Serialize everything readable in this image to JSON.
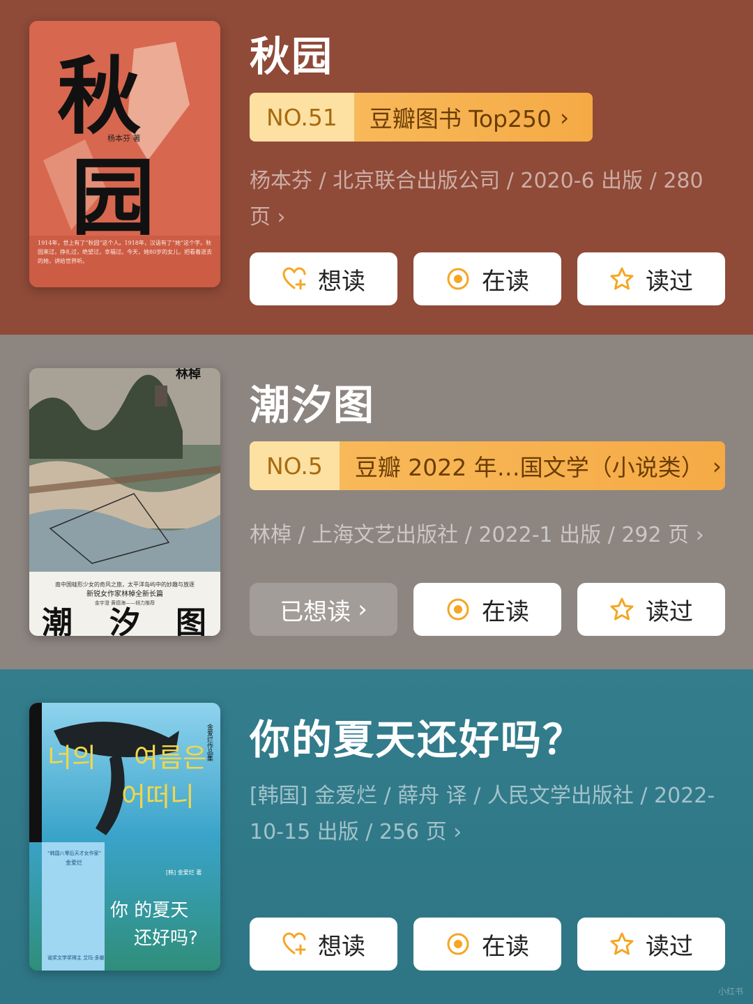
{
  "books": [
    {
      "title": "秋园",
      "rank_no": "NO.51",
      "rank_list": "豆瓣图书 Top250",
      "meta": "杨本芬 / 北京联合出版公司 / 2020-6 出版 / 280 页",
      "buttons": {
        "want": "想读",
        "reading": "在读",
        "read": "读过"
      },
      "cover": {
        "title_char_1": "秋",
        "title_char_2": "园",
        "author": "杨本芬 著",
        "blurb": "1914年，世上有了“秋园”这个人。1918年，汉语有了“她”这个字。秋园来过，挣扎过，绝望过，幸福过。今天，她80岁的女儿，把看着逝去的她，讲给世界听。"
      },
      "colors": {
        "bg": "#8f4a38",
        "cover": "#d8674f"
      }
    },
    {
      "title": "潮汐图",
      "rank_no": "NO.5",
      "rank_list": "豆瓣 2022 年…国文学（小说类）",
      "meta": "林棹 / 上海文艺出版社 / 2022-1 出版 / 292 页",
      "buttons": {
        "want": "已想读",
        "reading": "在读",
        "read": "读过"
      },
      "cover": {
        "author": "林棹",
        "line1": "南中国蛙形少女的奇风之旅，太平洋岛屿中的妙趣与放逐",
        "line2": "新锐女作家林棹全新长篇",
        "line3": "金宇澄  黄德海——倾力推荐",
        "title_chars": [
          "潮",
          "汐",
          "图"
        ]
      },
      "colors": {
        "bg": "#8d8580"
      }
    },
    {
      "title": "你的夏天还好吗？",
      "meta": "[韩国] 金爱烂 / 薛舟 译 / 人民文学出版社 / 2022-10-15 出版 / 256 页",
      "buttons": {
        "want": "想读",
        "reading": "在读",
        "read": "读过"
      },
      "cover": {
        "korean_1": "너의",
        "korean_2": "여름은",
        "korean_3": "어떠니",
        "side_label": "金爱烂作品集",
        "tag1": "“韩国八零后天才女作家”",
        "tag2": "金爱烂",
        "author_small": "[韩] 金爱烂 著",
        "title_1": "你  的夏天",
        "title_2": "还好吗?",
        "blurb_end": "诺奖文学奖得主 艾玛·多娜"
      },
      "colors": {
        "bg": "#337d8d"
      }
    }
  ],
  "watermark": "小红书",
  "icons": {
    "want": "heart-plus-icon",
    "reading": "radio-target-icon",
    "read": "star-outline-icon",
    "chevron": "chevron-right-icon"
  },
  "accent": {
    "orange": "#f5a623",
    "rank_light": "#fde1a2"
  }
}
